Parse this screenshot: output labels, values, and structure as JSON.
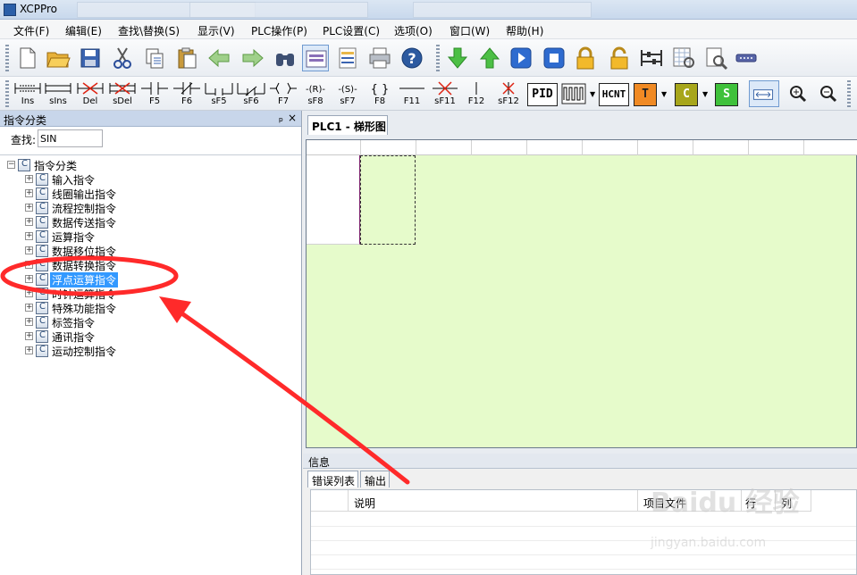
{
  "window": {
    "title": "XCPPro"
  },
  "menu": [
    "文件(F)",
    "编辑(E)",
    "查找\\替换(S)",
    "显示(V)",
    "PLC操作(P)",
    "PLC设置(C)",
    "选项(O)",
    "窗口(W)",
    "帮助(H)"
  ],
  "ladder_toolbar": {
    "labels": [
      "Ins",
      "sIns",
      "Del",
      "sDel",
      "F5",
      "F6",
      "sF5",
      "sF6",
      "F7",
      "sF8",
      "sF7",
      "F8",
      "F11",
      "sF11",
      "F12",
      "sF12"
    ],
    "symbols": [
      "-(R)-",
      "-(S)-",
      "{  }"
    ],
    "big_buttons": [
      "PID",
      "HCNT",
      "T",
      "C",
      "S"
    ]
  },
  "left_panel": {
    "title": "指令分类",
    "pin_glyph": "ₚ",
    "close_glyph": "×",
    "search_label": "查找:",
    "search_value": "SIN",
    "tree_root": "指令分类",
    "tree_items": [
      "输入指令",
      "线圈输出指令",
      "流程控制指令",
      "数据传送指令",
      "运算指令",
      "数据移位指令",
      "数据转换指令",
      "浮点运算指令",
      "时钟运算指令",
      "特殊功能指令",
      "标签指令",
      "通讯指令",
      "运动控制指令"
    ],
    "selected_item": "浮点运算指令",
    "expander": "+",
    "root_expander": "−"
  },
  "document": {
    "tab_label": "PLC1 - 梯形图"
  },
  "info_panel": {
    "title": "信息",
    "tabs": [
      "错误列表",
      "输出"
    ],
    "columns": [
      "说明",
      "项目文件",
      "行",
      "列"
    ]
  },
  "watermark": {
    "brand": "Baidu 经验",
    "site": "jingyan.baidu.com"
  },
  "colors": {
    "ladder_bg": "#e6fbcb",
    "selection": "#3399ff",
    "annotation": "#ff2a2a"
  }
}
